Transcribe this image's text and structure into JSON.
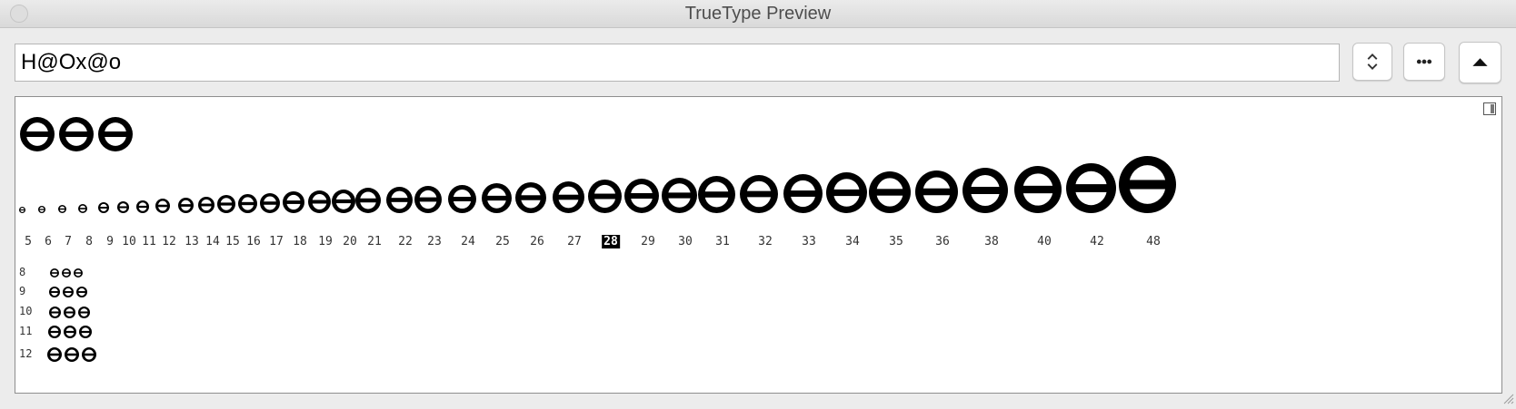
{
  "window": {
    "title": "TrueType Preview"
  },
  "input": {
    "value": "H@Ox@o"
  },
  "glyph_text_repeat": 3,
  "sizes": [
    5,
    6,
    7,
    8,
    9,
    10,
    11,
    12,
    13,
    14,
    15,
    16,
    17,
    18,
    19,
    20,
    21,
    22,
    23,
    24,
    25,
    26,
    27,
    28,
    29,
    30,
    31,
    32,
    33,
    34,
    35,
    36,
    38,
    40,
    42,
    48
  ],
  "size_labels": [
    "5",
    "6",
    "7",
    "8",
    "9",
    "10",
    "11",
    "12",
    "13",
    "14",
    "15",
    "16",
    "17",
    "18",
    "19",
    "20",
    "21",
    "22",
    "23",
    "24",
    "25",
    "26",
    "27",
    "28",
    "29",
    "30",
    "31",
    "32",
    "33",
    "34",
    "35",
    "36",
    "38",
    "40",
    "42",
    "48"
  ],
  "selected_size": "28",
  "waterfall_rows": [
    {
      "label": "8",
      "size": 8
    },
    {
      "label": "9",
      "size": 9
    },
    {
      "label": "10",
      "size": 10
    },
    {
      "label": "11",
      "size": 11
    },
    {
      "label": "12",
      "size": 12
    }
  ]
}
